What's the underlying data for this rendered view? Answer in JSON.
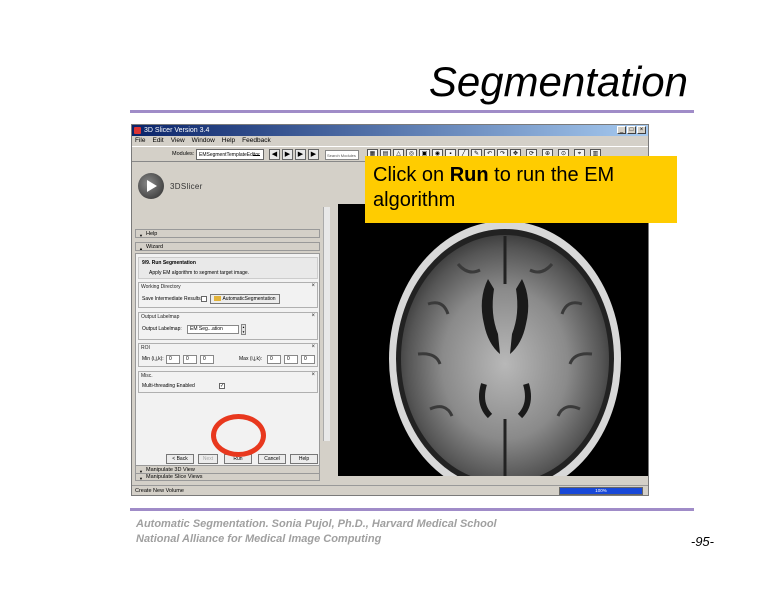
{
  "slide": {
    "title": "Segmentation",
    "footer_line1": "Automatic Segmentation. Sonia Pujol, Ph.D., Harvard Medical School",
    "footer_line2": "National Alliance for Medical Image Computing",
    "page_number": "-95-"
  },
  "window": {
    "title": "3D Slicer Version 3.4",
    "menu": [
      "File",
      "Edit",
      "View",
      "Window",
      "Help",
      "Feedback"
    ],
    "toolbar": {
      "modules_label": "Modules:",
      "module_selected": "EMSegmentTemplateEditor",
      "module_search": "Search Modules",
      "nav_buttons": [
        "◀",
        "▶",
        "▶",
        "▶"
      ]
    },
    "logo_text": "3DSlicer",
    "sections": {
      "help": "Help",
      "wizard": "Wizard",
      "slice_views": "Manipulate Slice Views",
      "views_3d": "Manipulate 3D View"
    },
    "step": {
      "title": "9/9. Run Segmentation",
      "description": "Apply EM algorithm to segment target image."
    },
    "working_directory": {
      "group_title": "Working Directory",
      "label": "Save Intermediate Results",
      "button": "AutomaticSegmentation"
    },
    "output_labelmap": {
      "group_title": "Output Labelmap",
      "label": "Output Labelmap:",
      "value": "EM Seg...ation"
    },
    "roi": {
      "group_title": "ROI",
      "min_label": "Min (i,j,k):",
      "min_values": [
        "0",
        "0",
        "0"
      ],
      "max_label": "Max (i,j,k):",
      "max_values": [
        "0",
        "0",
        "0"
      ]
    },
    "misc": {
      "group_title": "Misc.",
      "label": "Multi-threading Enabled",
      "checked": true,
      "check_mark": "✓"
    },
    "buttons": {
      "back": "< Back",
      "next": "Next",
      "run": "Run",
      "cancel": "Cancel",
      "help": "Help"
    },
    "status": {
      "text": "Create New Volume",
      "progress_label": "100%",
      "progress_value": 1.0,
      "progress_color": "#1848d8"
    }
  },
  "callout": {
    "prefix": "Click on ",
    "bold": "Run",
    "suffix": " to run the EM algorithm",
    "color": "#ffcc00"
  },
  "highlight_color": "#e8381e"
}
